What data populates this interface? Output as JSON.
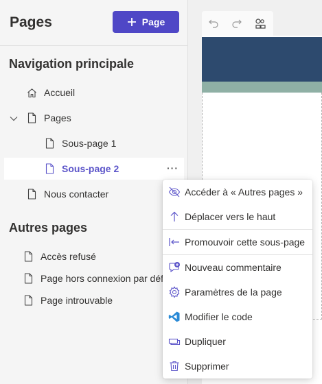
{
  "left_pane": {
    "title": "Pages",
    "add_page_label": "Page",
    "main_nav": {
      "title": "Navigation principale",
      "items": [
        {
          "label": "Accueil",
          "icon": "home-icon"
        },
        {
          "label": "Pages",
          "icon": "page-icon",
          "expanded": true
        },
        {
          "label": "Sous-page 1",
          "icon": "page-icon"
        },
        {
          "label": "Sous-page 2",
          "icon": "page-icon",
          "selected": true
        },
        {
          "label": "Nous contacter",
          "icon": "page-icon"
        }
      ],
      "more_label": "···"
    },
    "other_pages": {
      "title": "Autres pages",
      "items": [
        {
          "label": "Accès refusé",
          "icon": "page-icon"
        },
        {
          "label": "Page hors connexion par défaut",
          "icon": "page-icon"
        },
        {
          "label": "Page introuvable",
          "icon": "page-icon"
        }
      ]
    }
  },
  "canvas": {
    "header_color": "#2d4a6e",
    "band_color": "#8fb0a5",
    "toolbar": [
      "undo-icon",
      "redo-icon",
      "sitemap-icon"
    ]
  },
  "context_menu": {
    "items": [
      {
        "label": "Accéder à « Autres pages »",
        "icon": "hide-icon"
      },
      {
        "label": "Déplacer vers le haut",
        "icon": "arrow-up-icon"
      },
      {
        "label": "Promouvoir cette sous-page",
        "icon": "promote-icon"
      },
      {
        "label": "Nouveau commentaire",
        "icon": "comment-add-icon"
      },
      {
        "label": "Paramètres de la page",
        "icon": "settings-icon"
      },
      {
        "label": "Modifier le code",
        "icon": "vscode-icon"
      },
      {
        "label": "Dupliquer",
        "icon": "duplicate-icon"
      },
      {
        "label": "Supprimer",
        "icon": "delete-icon"
      }
    ]
  },
  "colors": {
    "accent": "#4f47c6",
    "selected_text": "#5b54c9"
  }
}
